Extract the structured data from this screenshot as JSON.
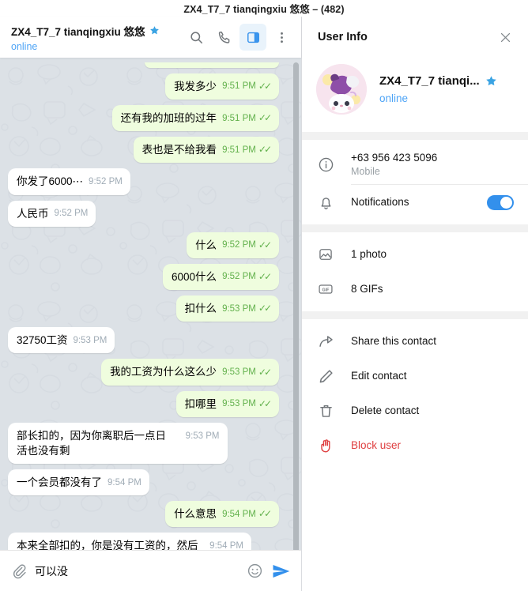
{
  "window": {
    "title": "ZX4_T7_7 tianqingxiu 悠悠 – (482)"
  },
  "chat_header": {
    "title": "ZX4_T7_7 tianqingxiu 悠悠",
    "verified_icon": "star-icon",
    "status": "online",
    "icons": [
      {
        "name": "search-icon",
        "active": false
      },
      {
        "name": "phone-icon",
        "active": false
      },
      {
        "name": "toggle-info-panel-icon",
        "active": true
      },
      {
        "name": "more-options-icon",
        "active": false
      }
    ]
  },
  "messages": [
    {
      "id": "m0",
      "dir": "out",
      "partial": true,
      "text": "",
      "time": "",
      "ticks": ""
    },
    {
      "id": "m1",
      "dir": "out",
      "text": "我发多少",
      "time": "9:51 PM",
      "ticks": "✓✓"
    },
    {
      "id": "m2",
      "dir": "out",
      "text": "还有我的加班的过年",
      "time": "9:51 PM",
      "ticks": "✓✓"
    },
    {
      "id": "m3",
      "dir": "out",
      "text": "表也是不给我看",
      "time": "9:51 PM",
      "ticks": "✓✓"
    },
    {
      "id": "m4",
      "dir": "in",
      "text": "你发了6000⋯",
      "time": "9:52 PM",
      "ticks": ""
    },
    {
      "id": "m5",
      "dir": "in",
      "text": "人民币",
      "time": "9:52 PM",
      "ticks": ""
    },
    {
      "id": "m6",
      "dir": "out",
      "text": "什么",
      "time": "9:52 PM",
      "ticks": "✓✓"
    },
    {
      "id": "m7",
      "dir": "out",
      "text": "6000什么",
      "time": "9:52 PM",
      "ticks": "✓✓"
    },
    {
      "id": "m8",
      "dir": "out",
      "text": "扣什么",
      "time": "9:53 PM",
      "ticks": "✓✓"
    },
    {
      "id": "m9",
      "dir": "in",
      "text": "32750工资",
      "time": "9:53 PM",
      "ticks": ""
    },
    {
      "id": "m10",
      "dir": "out",
      "text": "我的工资为什么这么少",
      "time": "9:53 PM",
      "ticks": "✓✓"
    },
    {
      "id": "m11",
      "dir": "out",
      "text": "扣哪里",
      "time": "9:53 PM",
      "ticks": "✓✓"
    },
    {
      "id": "m12",
      "dir": "in",
      "wrap": true,
      "text": "部长扣的，因为你离职后一点日活也没有剩",
      "time": "9:53 PM",
      "ticks": ""
    },
    {
      "id": "m13",
      "dir": "in",
      "text": "一个会员都没有了",
      "time": "9:54 PM",
      "ticks": ""
    },
    {
      "id": "m14",
      "dir": "out",
      "text": "什么意思",
      "time": "9:54 PM",
      "ticks": "✓✓"
    },
    {
      "id": "m15",
      "dir": "in",
      "wrap": true,
      "text": "本来全部扣的，你是没有工资的，然后老大帮你争取了一半·～",
      "time": "9:54 PM",
      "ticks": ""
    }
  ],
  "composer": {
    "attach_icon": "paperclip-icon",
    "value": "可以没",
    "placeholder": "Message",
    "emoji_icon": "smiley-icon",
    "send_icon": "send-icon"
  },
  "info_panel": {
    "title": "User Info",
    "close_icon": "close-icon",
    "profile": {
      "name": "ZX4_T7_7 tianqi...",
      "status": "online",
      "verified_icon": "star-icon",
      "avatar_icon": "avatar"
    },
    "contact": {
      "icon": "info-icon",
      "phone": "+63 956 423 5096",
      "phone_label": "Mobile"
    },
    "notifications": {
      "icon": "bell-icon",
      "label": "Notifications",
      "enabled": true
    },
    "media": [
      {
        "icon": "photo-icon",
        "label": "1 photo"
      },
      {
        "icon": "gif-icon",
        "label": "8 GIFs"
      }
    ],
    "actions": [
      {
        "icon": "share-icon",
        "label": "Share this contact",
        "danger": false
      },
      {
        "icon": "pencil-icon",
        "label": "Edit contact",
        "danger": false
      },
      {
        "icon": "trash-icon",
        "label": "Delete contact",
        "danger": false
      },
      {
        "icon": "hand-icon",
        "label": "Block user",
        "danger": true
      }
    ]
  },
  "colors": {
    "accent": "#3390ec",
    "out_bubble": "#effdde",
    "in_bubble": "#ffffff",
    "chat_bg": "#dce1e6",
    "danger": "#df3f40",
    "tick_green": "#62b14c"
  }
}
